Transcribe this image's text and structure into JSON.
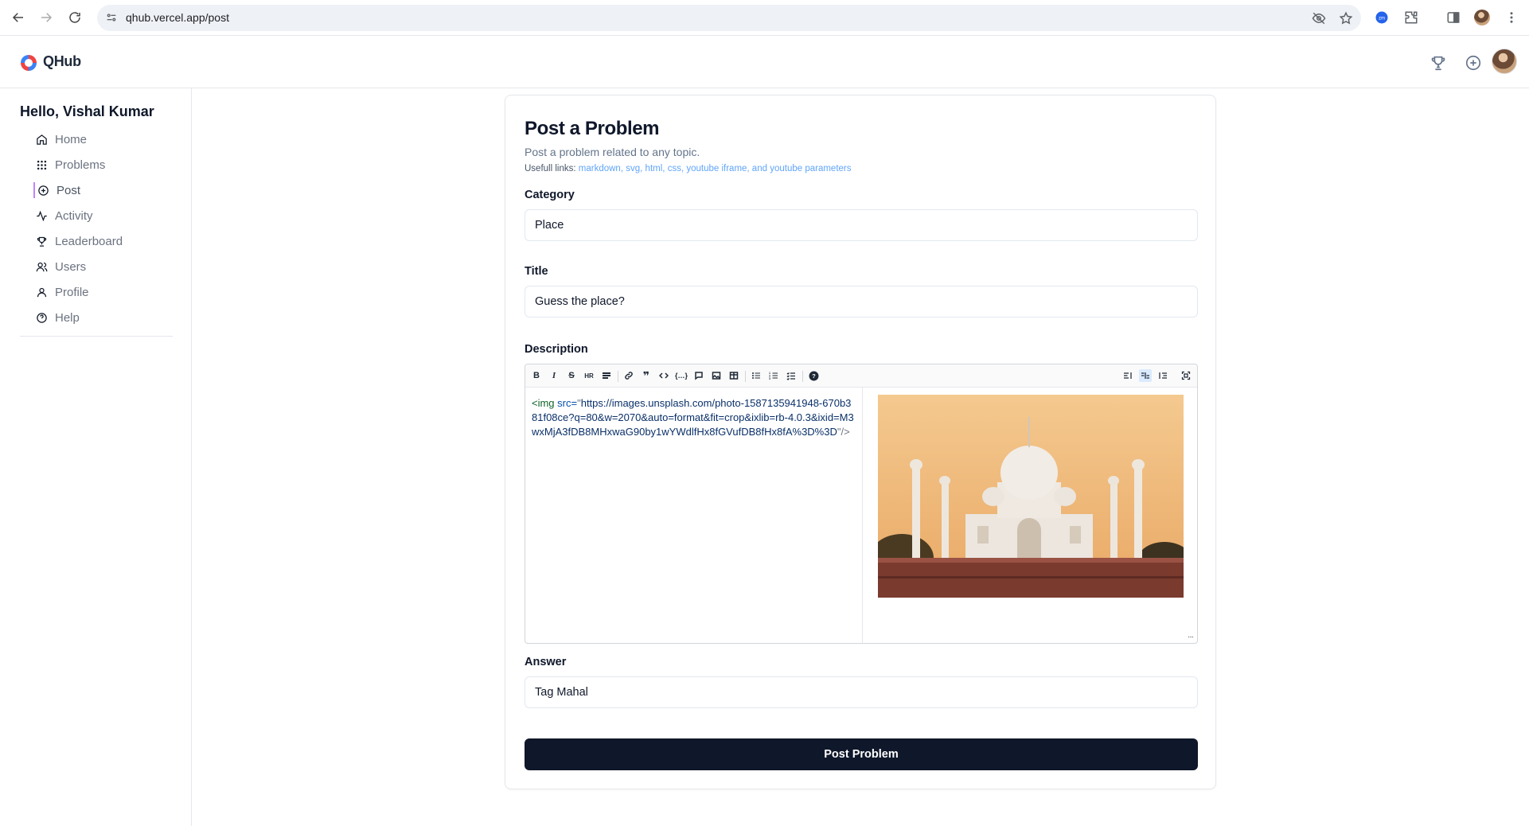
{
  "browser": {
    "url": "qhub.vercel.app/post"
  },
  "header": {
    "brand": "QHub"
  },
  "sidebar": {
    "greeting": "Hello, Vishal Kumar",
    "items": [
      {
        "label": "Home",
        "icon": "home-icon"
      },
      {
        "label": "Problems",
        "icon": "grid-icon"
      },
      {
        "label": "Post",
        "icon": "plus-circle-icon",
        "active": true
      },
      {
        "label": "Activity",
        "icon": "activity-icon"
      },
      {
        "label": "Leaderboard",
        "icon": "trophy-icon"
      },
      {
        "label": "Users",
        "icon": "users-icon"
      },
      {
        "label": "Profile",
        "icon": "user-icon"
      },
      {
        "label": "Help",
        "icon": "help-circle-icon"
      }
    ]
  },
  "form": {
    "title": "Post a Problem",
    "subtitle": "Post a problem related to any topic.",
    "links_prefix": "Usefull links:",
    "links": [
      "markdown",
      "svg",
      "html",
      "css",
      "youtube iframe",
      "youtube parameters"
    ],
    "category_label": "Category",
    "category_value": "Place",
    "title_label": "Title",
    "title_value": "Guess the place?",
    "description_label": "Description",
    "description_tag": "<img",
    "description_attr": " src=",
    "description_quote_open": "\"",
    "description_url": "https://images.unsplash.com/photo-1587135941948-670b381f08ce?q=80&w=2070&auto=format&fit=crop&ixlib=rb-4.0.3&ixid=M3wxMjA3fDB8MHxwaG90by1wYWdlfHx8fGVufDB8fHx8fA%3D%3D",
    "description_close": "\"/>",
    "answer_label": "Answer",
    "answer_value": "Tag Mahal",
    "submit_label": "Post Problem"
  },
  "colors": {
    "primary": "#0f172a",
    "link": "#60a5fa",
    "active_indicator": "#c084fc"
  }
}
